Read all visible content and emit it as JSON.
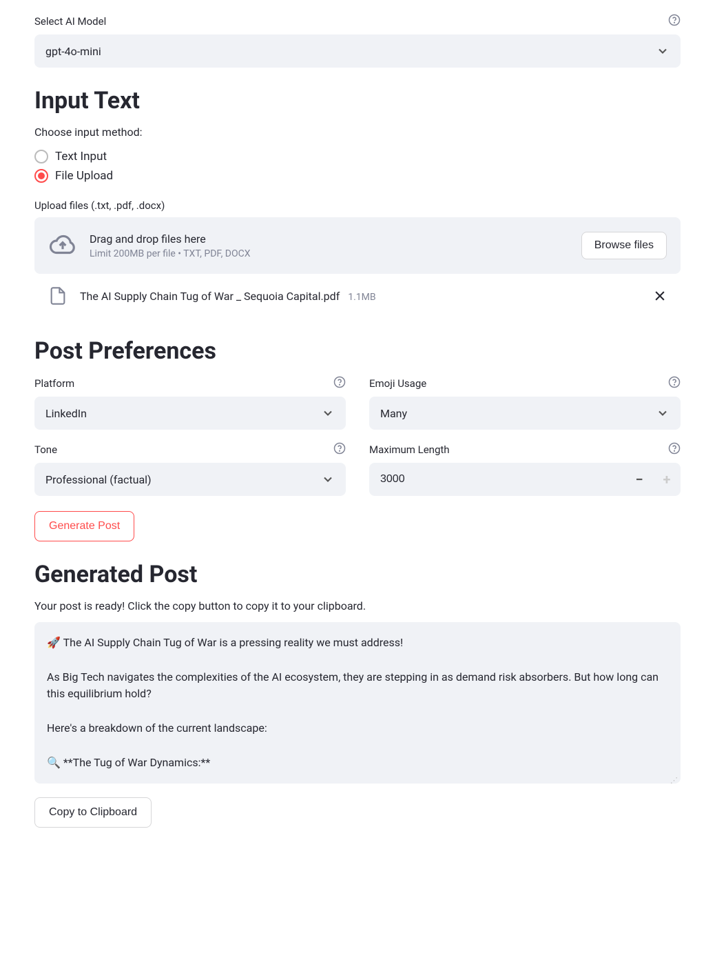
{
  "model_select": {
    "label": "Select AI Model",
    "value": "gpt-4o-mini"
  },
  "input_section": {
    "heading": "Input Text",
    "method_label": "Choose input method:",
    "radio_options": {
      "text_input": "Text Input",
      "file_upload": "File Upload"
    },
    "selected_method": "file_upload",
    "upload_label": "Upload files (.txt, .pdf, .docx)",
    "dropzone": {
      "title": "Drag and drop files here",
      "sub": "Limit 200MB per file • TXT, PDF, DOCX",
      "browse_label": "Browse files"
    },
    "uploaded_file": {
      "name": "The AI Supply Chain Tug of War _ Sequoia Capital.pdf",
      "size": "1.1MB"
    }
  },
  "preferences": {
    "heading": "Post Preferences",
    "platform": {
      "label": "Platform",
      "value": "LinkedIn"
    },
    "emoji": {
      "label": "Emoji Usage",
      "value": "Many"
    },
    "tone": {
      "label": "Tone",
      "value": "Professional (factual)"
    },
    "max_length": {
      "label": "Maximum Length",
      "value": "3000"
    }
  },
  "generate_button_label": "Generate Post",
  "output": {
    "heading": "Generated Post",
    "ready_text": "Your post is ready! Click the copy button to copy it to your clipboard.",
    "post_text": "🚀 The AI Supply Chain Tug of War is a pressing reality we must address!\n\nAs Big Tech navigates the complexities of the AI ecosystem, they are stepping in as demand risk absorbers. But how long can this equilibrium hold?\n\nHere's a breakdown of the current landscape:\n\n🔍 **The Tug of War Dynamics:**",
    "copy_label": "Copy to Clipboard"
  }
}
